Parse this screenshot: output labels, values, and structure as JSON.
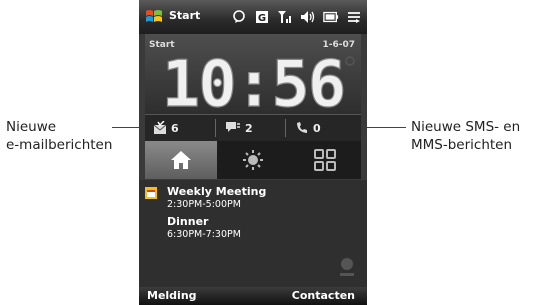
{
  "callouts": {
    "left_line1": "Nieuwe",
    "left_line2": "e-mailberichten",
    "right_line1": "Nieuwe SMS- en",
    "right_line2": "MMS-berichten"
  },
  "title_bar": {
    "title": "Start"
  },
  "status_icons": [
    "messenger-icon",
    "gprs-icon",
    "signal-icon",
    "volume-icon",
    "battery-icon",
    "connectivity-icon"
  ],
  "clock_panel": {
    "label": "Start",
    "date": "1-6-07",
    "time": "10:56"
  },
  "notifications": {
    "email_count": "6",
    "sms_count": "2",
    "missed_calls": "0"
  },
  "tabs": [
    "home-tab",
    "settings-tab",
    "programs-tab"
  ],
  "agenda": {
    "events": [
      {
        "title": "Weekly Meeting",
        "time": "2:30PM-5:00PM"
      },
      {
        "title": "Dinner",
        "time": "6:30PM-7:30PM"
      }
    ]
  },
  "softkeys": {
    "left": "Melding",
    "right": "Contacten"
  },
  "colors": {
    "phone_bg": "#3a3a3a",
    "text": "#ffffff",
    "tab_active": "#7a7a7a"
  }
}
